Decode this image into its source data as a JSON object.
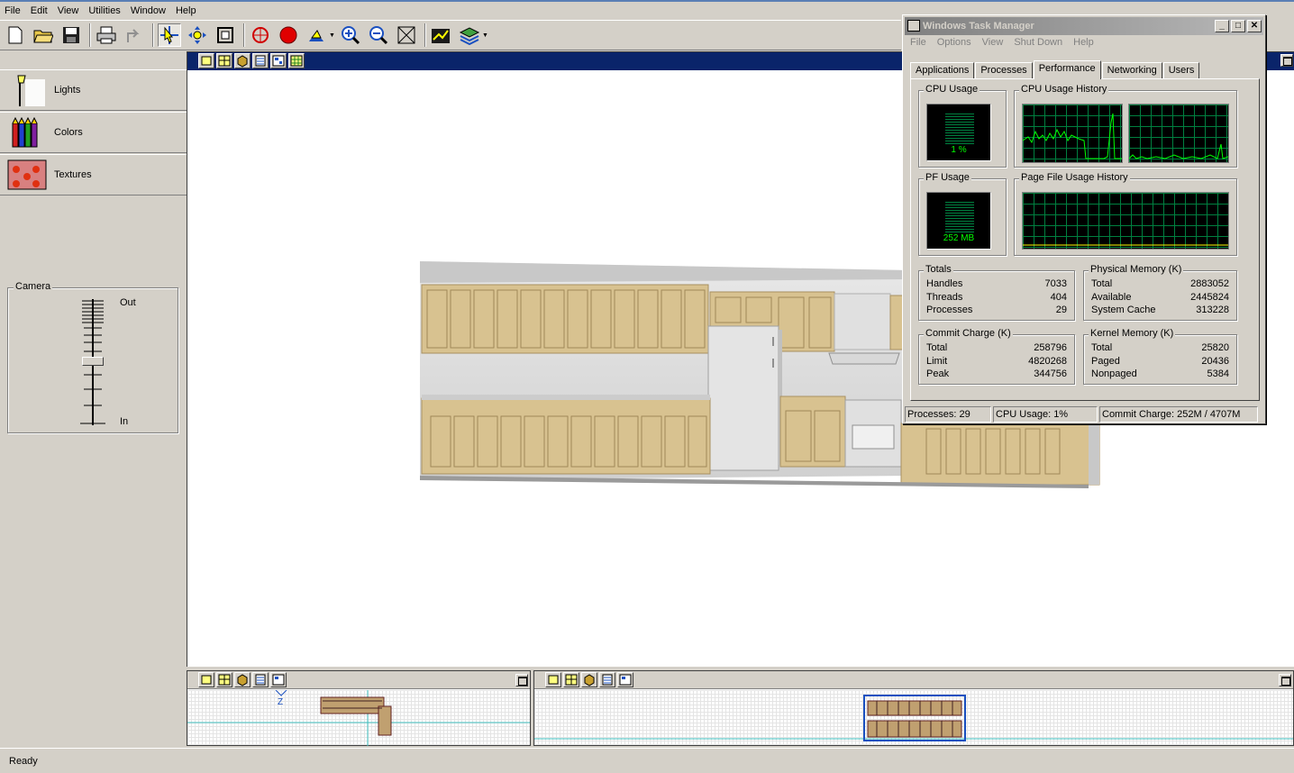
{
  "menu": [
    "File",
    "Edit",
    "View",
    "Utilities",
    "Window",
    "Help"
  ],
  "toolbar": {
    "buttons": [
      "new-icon",
      "open-icon",
      "save-icon",
      "print-icon",
      "up-icon",
      "select-icon",
      "pan-icon",
      "frame-icon",
      "target-icon",
      "record-icon",
      "walk-icon",
      "zoom-in-icon",
      "zoom-out-icon",
      "zoom-extents-icon",
      "render-icon",
      "layers-icon"
    ]
  },
  "left_panel": {
    "items": [
      {
        "label": "Lights",
        "icon": "lamp-icon"
      },
      {
        "label": "Colors",
        "icon": "crayons-icon"
      },
      {
        "label": "Textures",
        "icon": "textures-icon"
      }
    ],
    "camera": {
      "title": "Camera",
      "out_label": "Out",
      "in_label": "In",
      "level": 0.6
    }
  },
  "status": {
    "text": "Ready"
  },
  "taskmanager": {
    "title": "Windows Task Manager",
    "menu": [
      "File",
      "Options",
      "View",
      "Shut Down",
      "Help"
    ],
    "tabs": [
      "Applications",
      "Processes",
      "Performance",
      "Networking",
      "Users"
    ],
    "active_tab": "Performance",
    "cpu_usage": {
      "title": "CPU Usage",
      "value": "1 %"
    },
    "cpu_history": {
      "title": "CPU Usage History"
    },
    "pf_usage": {
      "title": "PF Usage",
      "value": "252 MB"
    },
    "pf_history": {
      "title": "Page File Usage History"
    },
    "totals": {
      "title": "Totals",
      "rows": [
        {
          "label": "Handles",
          "value": "7033"
        },
        {
          "label": "Threads",
          "value": "404"
        },
        {
          "label": "Processes",
          "value": "29"
        }
      ]
    },
    "physical": {
      "title": "Physical Memory (K)",
      "rows": [
        {
          "label": "Total",
          "value": "2883052"
        },
        {
          "label": "Available",
          "value": "2445824"
        },
        {
          "label": "System Cache",
          "value": "313228"
        }
      ]
    },
    "commit": {
      "title": "Commit Charge (K)",
      "rows": [
        {
          "label": "Total",
          "value": "258796"
        },
        {
          "label": "Limit",
          "value": "4820268"
        },
        {
          "label": "Peak",
          "value": "344756"
        }
      ]
    },
    "kernel": {
      "title": "Kernel Memory (K)",
      "rows": [
        {
          "label": "Total",
          "value": "25820"
        },
        {
          "label": "Paged",
          "value": "20436"
        },
        {
          "label": "Nonpaged",
          "value": "5384"
        }
      ]
    },
    "statusbar": {
      "processes": "Processes: 29",
      "cpu": "CPU Usage: 1%",
      "commit": "Commit Charge: 252M / 4707M"
    }
  },
  "colors": {
    "view_header": "#0a246a",
    "graph_line": "#00ff00",
    "cabinet": "#dcc79a"
  }
}
